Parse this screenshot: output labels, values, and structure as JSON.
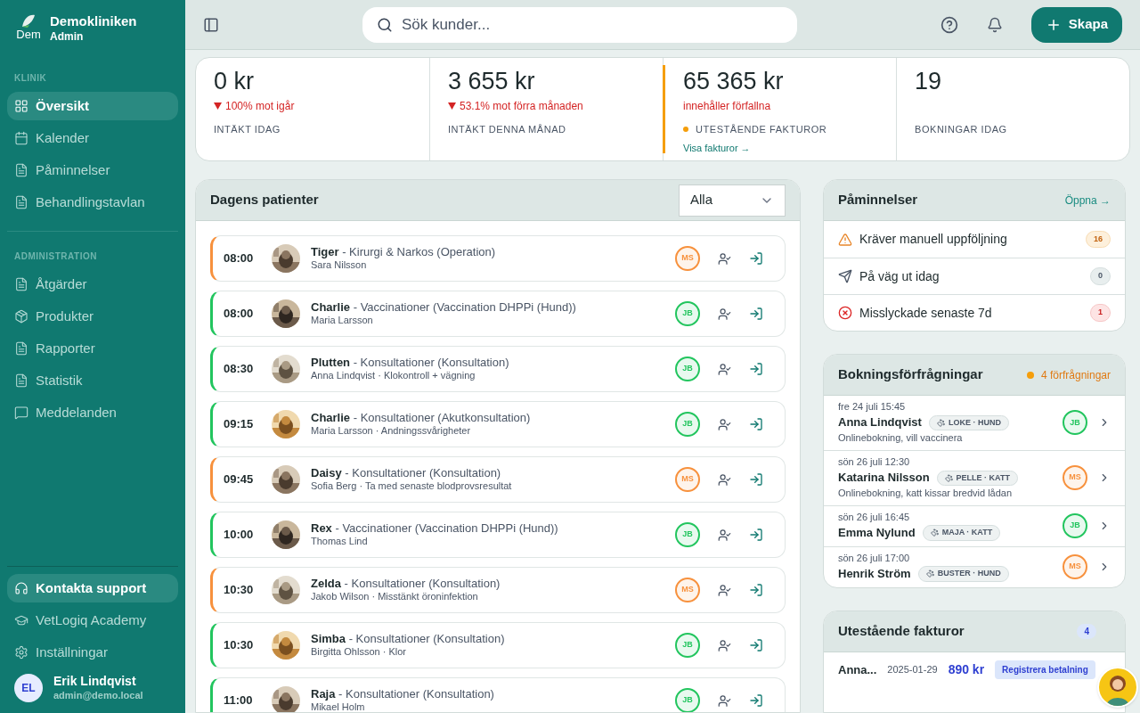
{
  "sidebar": {
    "logo_alt": "Dem",
    "clinic": "Demokliniken",
    "role": "Admin",
    "sections": [
      {
        "title": "KLINIK",
        "items": [
          {
            "label": "Översikt",
            "selected": true
          },
          {
            "label": "Kalender",
            "selected": false
          },
          {
            "label": "Påminnelser",
            "selected": false
          },
          {
            "label": "Behandlingstavlan",
            "selected": false
          }
        ]
      },
      {
        "title": "ADMINISTRATION",
        "items": [
          {
            "label": "Åtgärder",
            "selected": false
          },
          {
            "label": "Produkter",
            "selected": false
          },
          {
            "label": "Rapporter",
            "selected": false
          },
          {
            "label": "Statistik",
            "selected": false
          },
          {
            "label": "Meddelanden",
            "selected": false
          }
        ]
      }
    ],
    "footer_items": [
      {
        "label": "Kontakta support",
        "selected": true
      },
      {
        "label": "VetLogiq Academy",
        "selected": false
      },
      {
        "label": "Inställningar",
        "selected": false
      }
    ],
    "user": {
      "initials": "EL",
      "name": "Erik Lindqvist",
      "email": "admin@demo.local"
    }
  },
  "header": {
    "search": {
      "placeholder": "Sök kunder..."
    },
    "create_button": "Skapa"
  },
  "stats": [
    {
      "kind": "trend",
      "value": "0 kr",
      "note": "100% mot igår",
      "label": "INTÄKT IDAG"
    },
    {
      "kind": "trend",
      "value": "3 655 kr",
      "note": "53.1% mot förra månaden",
      "label": "INTÄKT DENNA MÅNAD"
    },
    {
      "kind": "alert",
      "value": "65 365 kr",
      "note": "innehåller förfallna",
      "label": "UTESTÅENDE FAKTUROR",
      "link": "Visa fakturor →"
    },
    {
      "kind": "plain",
      "value": "19",
      "label": "BOKNINGAR IDAG"
    }
  ],
  "patients_panel": {
    "title": "Dagens patienter",
    "filter": "Alla",
    "patients": [
      {
        "time": "08:00",
        "name": "Tiger",
        "service": " - Kirurgi & Narkos (Operation)",
        "details": "Sara Nilsson",
        "vet": {
          "initials": "MS",
          "color": "#f7913d"
        }
      },
      {
        "time": "08:00",
        "name": "Charlie",
        "service": " - Vaccinationer (Vaccination DHPPi (Hund))",
        "details": "Maria Larsson",
        "vet": {
          "initials": "JB",
          "color": "#22c55e"
        }
      },
      {
        "time": "08:30",
        "name": "Plutten",
        "service": " - Konsultationer (Konsultation)",
        "details": "Anna Lindqvist · Klokontroll + vägning",
        "vet": {
          "initials": "JB",
          "color": "#22c55e"
        }
      },
      {
        "time": "09:15",
        "name": "Charlie",
        "service": " - Konsultationer (Akutkonsultation)",
        "details": "Maria Larsson · Andningssvårigheter",
        "vet": {
          "initials": "JB",
          "color": "#22c55e"
        }
      },
      {
        "time": "09:45",
        "name": "Daisy",
        "service": " - Konsultationer (Konsultation)",
        "details": "Sofia Berg · Ta med senaste blodprovsresultat",
        "vet": {
          "initials": "MS",
          "color": "#f7913d"
        }
      },
      {
        "time": "10:00",
        "name": "Rex",
        "service": " - Vaccinationer (Vaccination DHPPi (Hund))",
        "details": "Thomas Lind",
        "vet": {
          "initials": "JB",
          "color": "#22c55e"
        }
      },
      {
        "time": "10:30",
        "name": "Zelda",
        "service": " - Konsultationer (Konsultation)",
        "details": "Jakob Wilson · Misstänkt öroninfektion",
        "vet": {
          "initials": "MS",
          "color": "#f7913d"
        }
      },
      {
        "time": "10:30",
        "name": "Simba",
        "service": " - Konsultationer (Konsultation)",
        "details": "Birgitta Ohlsson · Klor",
        "vet": {
          "initials": "JB",
          "color": "#22c55e"
        }
      },
      {
        "time": "11:00",
        "name": "Raja",
        "service": " - Konsultationer (Konsultation)",
        "details": "Mikael Holm",
        "vet": {
          "initials": "JB",
          "color": "#22c55e"
        }
      }
    ]
  },
  "reminders": {
    "title": "Påminnelser",
    "link": "Öppna →",
    "items": [
      {
        "label": "Kräver manuell uppföljning",
        "count": "16",
        "kind": "warning"
      },
      {
        "label": "På väg ut idag",
        "count": "0",
        "kind": "sending"
      },
      {
        "label": "Misslyckade senaste 7d",
        "count": "1",
        "kind": "failed"
      }
    ]
  },
  "booking_requests": {
    "title": "Bokningsförfrågningar",
    "count": "4 förfrågningar",
    "requests": [
      {
        "date": "fre 24 juli 15:45",
        "name": "Anna Lindqvist",
        "pet": "LOKE · HUND",
        "note": "Onlinebokning, vill vaccinera",
        "vet": {
          "initials": "JB",
          "color": "#22c55e"
        }
      },
      {
        "date": "sön 26 juli 12:30",
        "name": "Katarina Nilsson",
        "pet": "PELLE · KATT",
        "note": "Onlinebokning, katt kissar bredvid lådan",
        "vet": {
          "initials": "MS",
          "color": "#f7913d"
        }
      },
      {
        "date": "sön 26 juli 16:45",
        "name": "Emma Nylund",
        "pet": "MAJA · KATT",
        "vet": {
          "initials": "JB",
          "color": "#22c55e"
        }
      },
      {
        "date": "sön 26 juli 17:00",
        "name": "Henrik Ström",
        "pet": "BUSTER · HUND",
        "vet": {
          "initials": "MS",
          "color": "#f7913d"
        }
      }
    ]
  },
  "invoices": {
    "title": "Utestående fakturor",
    "count": "4",
    "rows": [
      {
        "customer": "Anna...",
        "date": "2025-01-29",
        "amount": "890 kr",
        "action": "Registrera betalning"
      }
    ]
  }
}
